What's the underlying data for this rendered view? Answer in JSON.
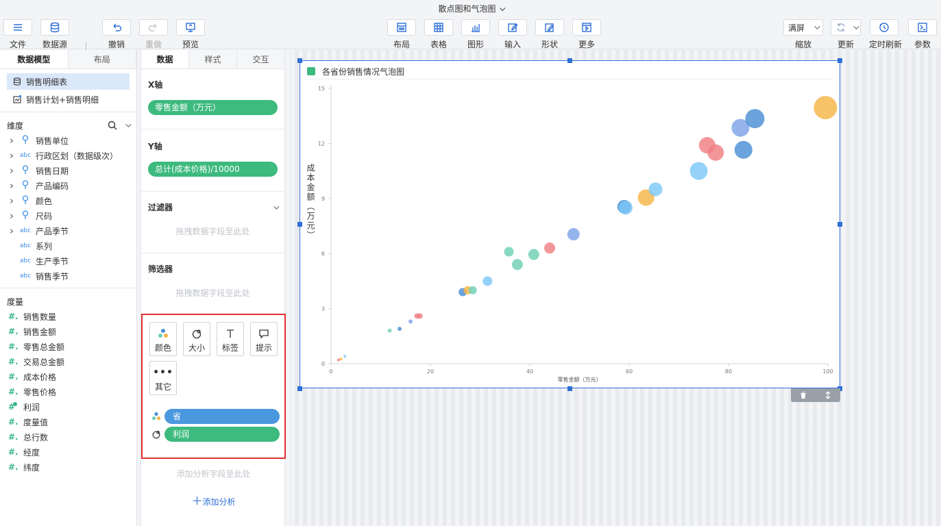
{
  "window": {
    "title": "散点图和气泡图"
  },
  "toolbar": {
    "file": "文件",
    "datasource": "数据源",
    "undo": "撤销",
    "redo": "重做",
    "preview": "预览",
    "layout": "布局",
    "table": "表格",
    "graph": "图形",
    "input": "输入",
    "shape": "形状",
    "more": "更多",
    "zoom_value": "满屏",
    "zoom": "缩放",
    "refresh": "更新",
    "timed_refresh": "定时刷新",
    "params": "参数"
  },
  "left": {
    "tabs": [
      "数据模型",
      "布局"
    ],
    "datasets": [
      "销售明细表",
      "销售计划+销售明细"
    ],
    "dimension_title": "维度",
    "dimensions": [
      {
        "label": "销售单位",
        "type": "pin",
        "expand": true
      },
      {
        "label": "行政区划（数据级次）",
        "type": "abc",
        "expand": true
      },
      {
        "label": "销售日期",
        "type": "pin",
        "expand": true
      },
      {
        "label": "产品编码",
        "type": "pin",
        "expand": true
      },
      {
        "label": "颜色",
        "type": "pin",
        "expand": true
      },
      {
        "label": "尺码",
        "type": "pin",
        "expand": true
      },
      {
        "label": "产品季节",
        "type": "abc",
        "expand": true
      },
      {
        "label": "系列",
        "type": "abc",
        "expand": false
      },
      {
        "label": "生产季节",
        "type": "abc",
        "expand": false
      },
      {
        "label": "销售季节",
        "type": "abc",
        "expand": false
      }
    ],
    "measure_title": "度量",
    "measures": [
      "销售数量",
      "销售金额",
      "零售总金额",
      "交易总金额",
      "成本价格",
      "零售价格",
      "利润",
      "度量值",
      "总行数",
      "经度",
      "纬度"
    ]
  },
  "mid": {
    "tabs": [
      "数据",
      "样式",
      "交互"
    ],
    "x_title": "X轴",
    "x_field": "零售金额（万元）",
    "y_title": "Y轴",
    "y_field": "总计(成本价格)/10000",
    "filter_title": "过滤器",
    "filter_hint": "拖拽数据字段至此处",
    "selector_title": "筛选器",
    "selector_hint": "拖拽数据字段至此处",
    "marks": [
      "颜色",
      "大小",
      "标签",
      "提示",
      "其它"
    ],
    "color_field": "省",
    "size_field": "利润",
    "add_hint": "添加分析字段至此处",
    "add_analysis": "添加分析"
  },
  "chart_data": {
    "type": "scatter",
    "title": "各省份销售情况气泡图",
    "xlabel": "零售金额（万元）",
    "ylabel": "成本金额（万元）",
    "xlim": [
      0,
      100
    ],
    "ylim": [
      0,
      15
    ],
    "xticks": [
      0,
      20,
      40,
      60,
      80,
      100
    ],
    "yticks": [
      0,
      3,
      6,
      9,
      12,
      15
    ],
    "palette": [
      "#4a8fd4",
      "#f5b547",
      "#6fcfb4",
      "#f07f84",
      "#7ea3e8",
      "#7cc8f8"
    ],
    "points": [
      {
        "x": 1.5,
        "y": 0.2,
        "s": 2,
        "c": 3
      },
      {
        "x": 2.0,
        "y": 0.25,
        "s": 2,
        "c": 1
      },
      {
        "x": 2.8,
        "y": 0.4,
        "s": 2,
        "c": 5
      },
      {
        "x": 11.8,
        "y": 1.8,
        "s": 3,
        "c": 2
      },
      {
        "x": 13.8,
        "y": 1.9,
        "s": 3,
        "c": 0
      },
      {
        "x": 16.0,
        "y": 2.3,
        "s": 3,
        "c": 4
      },
      {
        "x": 17.3,
        "y": 2.6,
        "s": 4,
        "c": 3
      },
      {
        "x": 17.9,
        "y": 2.6,
        "s": 4,
        "c": 3
      },
      {
        "x": 26.5,
        "y": 3.9,
        "s": 6,
        "c": 0
      },
      {
        "x": 27.5,
        "y": 4.0,
        "s": 6,
        "c": 1
      },
      {
        "x": 28.5,
        "y": 4.0,
        "s": 6,
        "c": 2
      },
      {
        "x": 31.5,
        "y": 4.5,
        "s": 7,
        "c": 5
      },
      {
        "x": 35.8,
        "y": 6.1,
        "s": 7,
        "c": 2
      },
      {
        "x": 37.5,
        "y": 5.4,
        "s": 8,
        "c": 2
      },
      {
        "x": 40.8,
        "y": 5.95,
        "s": 8,
        "c": 2
      },
      {
        "x": 44.0,
        "y": 6.3,
        "s": 8,
        "c": 3
      },
      {
        "x": 48.8,
        "y": 7.05,
        "s": 9,
        "c": 4
      },
      {
        "x": 59.0,
        "y": 8.55,
        "s": 10,
        "c": 0
      },
      {
        "x": 59.3,
        "y": 8.5,
        "s": 10,
        "c": 5
      },
      {
        "x": 63.4,
        "y": 9.05,
        "s": 12,
        "c": 1
      },
      {
        "x": 65.3,
        "y": 9.5,
        "s": 10,
        "c": 5
      },
      {
        "x": 74.0,
        "y": 10.5,
        "s": 13,
        "c": 5
      },
      {
        "x": 75.7,
        "y": 11.9,
        "s": 12,
        "c": 3
      },
      {
        "x": 77.4,
        "y": 11.5,
        "s": 12,
        "c": 3
      },
      {
        "x": 83.0,
        "y": 11.65,
        "s": 13,
        "c": 0
      },
      {
        "x": 82.4,
        "y": 12.85,
        "s": 13,
        "c": 4
      },
      {
        "x": 85.3,
        "y": 13.35,
        "s": 14,
        "c": 0
      },
      {
        "x": 99.5,
        "y": 13.95,
        "s": 17,
        "c": 1
      }
    ]
  }
}
